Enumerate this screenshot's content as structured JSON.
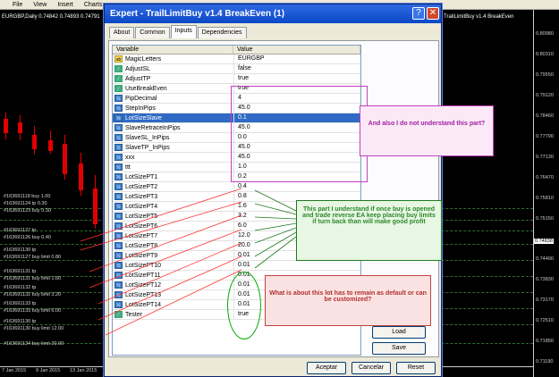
{
  "menu": [
    "File",
    "View",
    "Insert",
    "Charts"
  ],
  "chart": {
    "symbol_title": "EURGBP,Daily  0.74842 0.74893 0.74791",
    "window_title": "TrailLimitBuy v1.4 BreakEven",
    "price_ticks": [
      "0.80980",
      "0.80310",
      "0.79550",
      "0.79120",
      "0.78460",
      "0.77790",
      "0.77130",
      "0.76470",
      "0.75810",
      "0.75150",
      "0.74840",
      "0.74490",
      "0.73830",
      "0.73170",
      "0.72510",
      "0.71850",
      "0.71190"
    ],
    "highlighted_price": "0.74838",
    "date_ticks": [
      "7 Jan 2015",
      "9 Jan 2015",
      "13 Jan 2015"
    ],
    "order_labels": [
      "#163691118 buy 1.00",
      "#163691124 tp 0.30",
      "#163691123 buy 0.30",
      "#163691127 tp",
      "#163691126 buy 0.40",
      "#163691130 tp",
      "#163691127 buy limit 0.80",
      "#163691131 tp",
      "#163691131 buy limit 1.60",
      "#163691132 tp",
      "#163691132 buy limit 3.20",
      "#163691133 tp",
      "#163691133 buy limit 6.00",
      "#163691130 tp",
      "#163691130 buy limit 12.00",
      "#163691134 buy limit 20.00"
    ],
    "colors": {
      "background": "#000000",
      "candle": "#e00000",
      "grid_line": "#2f6f2f"
    }
  },
  "dialog": {
    "title": "Expert - TrailLimitBuy v1.4 BreakEven (1)",
    "help_glyph": "?",
    "close_glyph": "✕",
    "tabs": [
      "About",
      "Common",
      "Inputs",
      "Dependencies"
    ],
    "active_tab": "Inputs",
    "columns": [
      "Variable",
      "Value"
    ],
    "rows": [
      {
        "icon": "ab-icon",
        "name": "MagicLetters",
        "value": "EURGBP"
      },
      {
        "icon": "bool-icon",
        "name": "AdjustSL",
        "value": "false"
      },
      {
        "icon": "bool-icon",
        "name": "AdjustTP",
        "value": "true"
      },
      {
        "icon": "bool-icon",
        "name": "UseBreakEven",
        "value": "true"
      },
      {
        "icon": "number-icon",
        "name": "PipDecimal",
        "value": "4"
      },
      {
        "icon": "number-icon",
        "name": "StepInPips",
        "value": "45.0"
      },
      {
        "icon": "number-icon",
        "name": "LotSizeSlave",
        "value": "0.1",
        "selected": true
      },
      {
        "icon": "number-icon",
        "name": "SlaveRetraceInPips",
        "value": "45.0"
      },
      {
        "icon": "number-icon",
        "name": "SlaveSL_InPips",
        "value": "0.0"
      },
      {
        "icon": "number-icon",
        "name": "SlaveTP_InPips",
        "value": "45.0"
      },
      {
        "icon": "number-icon",
        "name": "xxx",
        "value": "45.0"
      },
      {
        "icon": "number-icon",
        "name": "ttt",
        "value": "1.0"
      },
      {
        "icon": "number-icon",
        "name": "LotSizePT1",
        "value": "0.2"
      },
      {
        "icon": "number-icon",
        "name": "LotSizePT2",
        "value": "0.4"
      },
      {
        "icon": "number-icon",
        "name": "LotSizePT3",
        "value": "0.8"
      },
      {
        "icon": "number-icon",
        "name": "LotSizePT4",
        "value": "1.6"
      },
      {
        "icon": "number-icon",
        "name": "LotSizePT5",
        "value": "3.2"
      },
      {
        "icon": "number-icon",
        "name": "LotSizePT6",
        "value": "6.0"
      },
      {
        "icon": "number-icon",
        "name": "LotSizePT7",
        "value": "12.0"
      },
      {
        "icon": "number-icon",
        "name": "LotSizePT8",
        "value": "20.0"
      },
      {
        "icon": "number-icon",
        "name": "LotSizePT9",
        "value": "0.01"
      },
      {
        "icon": "number-icon",
        "name": "LotSizePT10",
        "value": "0.01"
      },
      {
        "icon": "number-icon",
        "name": "LotSizePT11",
        "value": "0.01"
      },
      {
        "icon": "number-icon",
        "name": "LotSizePT12",
        "value": "0.01"
      },
      {
        "icon": "number-icon",
        "name": "LotSizePT13",
        "value": "0.01"
      },
      {
        "icon": "number-icon",
        "name": "LotSizePT14",
        "value": "0.01"
      },
      {
        "icon": "bool-icon",
        "name": "Tester",
        "value": "true"
      }
    ],
    "buttons": {
      "load": "Load",
      "save": "Save",
      "ok": "Aceptar",
      "cancel": "Cancelar",
      "reset": "Reset"
    }
  },
  "annotations": {
    "note1": "And also I do not understand this part?",
    "note2": "This part I understand if once buy is opened and trade reverse EA keep placing buy limits if turn back than will make good profit",
    "note3": "What is about this lot has to remain as default or can be customized?"
  }
}
